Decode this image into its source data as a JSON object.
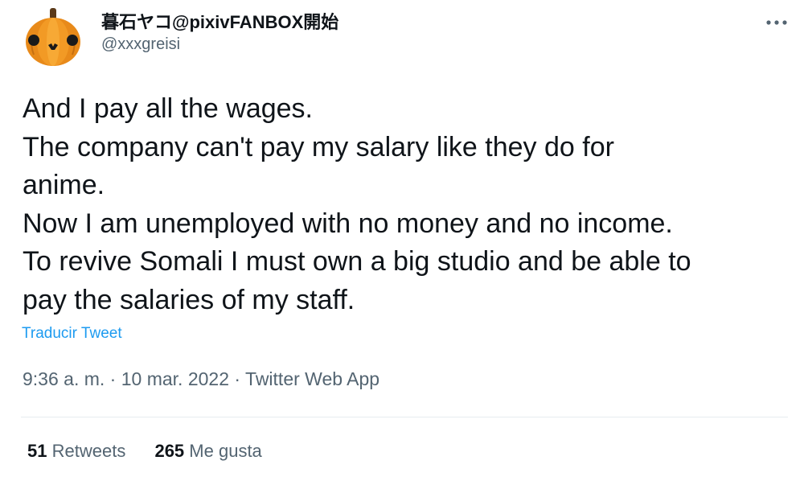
{
  "author": {
    "display_name": "暮石ヤコ@pixivFANBOX開始",
    "handle": "@xxxgreisi",
    "avatar_icon": "pumpkin-avatar-icon"
  },
  "tweet": {
    "lines": [
      "And I pay all the wages.",
      "The company can't pay my salary like they do for",
      "anime.",
      "Now I am unemployed with no money and no income.",
      "To revive Somali I must own a big studio and be able to",
      "pay the salaries of my staff."
    ],
    "translate_label": "Traducir Tweet"
  },
  "meta": {
    "time": "9:36 a. m.",
    "separator": "·",
    "date": "10 mar. 2022",
    "source": "Twitter Web App"
  },
  "stats": {
    "retweets_count": "51",
    "retweets_label": "Retweets",
    "likes_count": "265",
    "likes_label": "Me gusta"
  },
  "colors": {
    "text": "#0f1419",
    "secondary": "#536471",
    "link": "#1d9bf0",
    "divider": "#e6ecf0"
  },
  "icons": {
    "more": "more-horizontal-icon"
  }
}
